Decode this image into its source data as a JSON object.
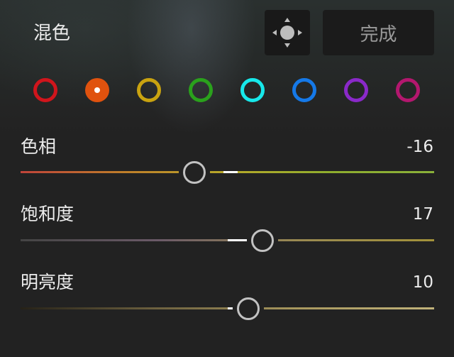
{
  "header": {
    "title": "混色",
    "done_label": "完成",
    "move_icon": "move-target-icon"
  },
  "swatches": [
    {
      "name": "red",
      "color": "#d0151c",
      "selected": false
    },
    {
      "name": "orange",
      "color": "#e0520e",
      "selected": true
    },
    {
      "name": "yellow",
      "color": "#c9a310",
      "selected": false
    },
    {
      "name": "green",
      "color": "#2aa11c",
      "selected": false
    },
    {
      "name": "aqua",
      "color": "#17e8ea",
      "selected": false
    },
    {
      "name": "blue",
      "color": "#1579e8",
      "selected": false
    },
    {
      "name": "purple",
      "color": "#8a29c9",
      "selected": false
    },
    {
      "name": "magenta",
      "color": "#b3176e",
      "selected": false
    }
  ],
  "sliders": {
    "hue": {
      "label": "色相",
      "value": "-16",
      "level": -16,
      "min": -100,
      "max": 100
    },
    "saturation": {
      "label": "饱和度",
      "value": "17",
      "level": 17,
      "min": -100,
      "max": 100
    },
    "luminance": {
      "label": "明亮度",
      "value": "10",
      "level": 10,
      "min": -100,
      "max": 100
    }
  },
  "colors": {
    "background": "#222222",
    "hue_track": [
      "#c0443a",
      "#bf7e2a",
      "#b7a92a",
      "#8fae2e",
      "#8ab03a"
    ],
    "saturation_track": [
      "#444444",
      "#6b5a68",
      "#9a8a52",
      "#a3923a"
    ],
    "luminance_track": [
      "#262218",
      "#6e6240",
      "#a8985e",
      "#c0b27a"
    ]
  }
}
